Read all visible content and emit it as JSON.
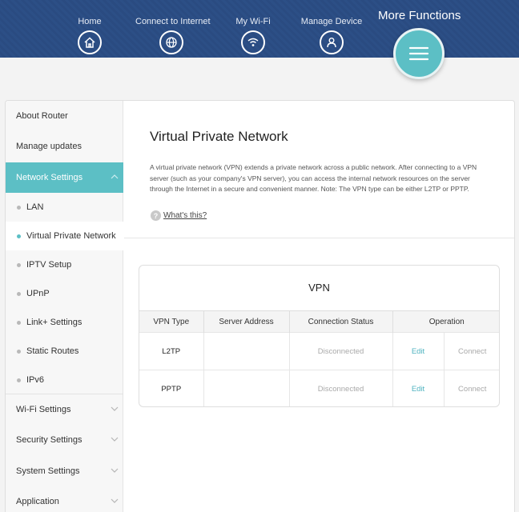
{
  "nav": {
    "items": [
      {
        "label": "Home",
        "icon": "home-icon"
      },
      {
        "label": "Connect to Internet",
        "icon": "globe-icon"
      },
      {
        "label": "My Wi-Fi",
        "icon": "wifi-icon"
      },
      {
        "label": "Manage Device",
        "icon": "user-icon"
      }
    ],
    "more_label": "More Functions",
    "more_icon": "menu-icon"
  },
  "sidebar": {
    "about": "About Router",
    "updates": "Manage updates",
    "network": "Network Settings",
    "sub": [
      "LAN",
      "Virtual Private Network",
      "IPTV Setup",
      "UPnP",
      "Link+ Settings",
      "Static Routes",
      "IPv6"
    ],
    "wifi": "Wi-Fi Settings",
    "security": "Security Settings",
    "system": "System Settings",
    "application": "Application"
  },
  "main": {
    "title": "Virtual Private Network",
    "description": "A virtual private network (VPN) extends a private network across a public network. After connecting to a VPN server (such as your company's VPN server), you can access the internal network resources on the server through the Internet in a secure and convenient manner. Note: The VPN type can be either L2TP or PPTP.",
    "help_icon": "?",
    "help_link": "What's this?"
  },
  "vpn_card": {
    "title": "VPN",
    "headers": {
      "type": "VPN Type",
      "server": "Server Address",
      "status": "Connection Status",
      "operation": "Operation"
    },
    "rows": [
      {
        "type": "L2TP",
        "server": "",
        "status": "Disconnected",
        "edit": "Edit",
        "connect": "Connect"
      },
      {
        "type": "PPTP",
        "server": "",
        "status": "Disconnected",
        "edit": "Edit",
        "connect": "Connect"
      }
    ]
  },
  "colors": {
    "accent": "#5cbfc5",
    "header": "#2c4f86",
    "link": "#4fb3c0"
  }
}
